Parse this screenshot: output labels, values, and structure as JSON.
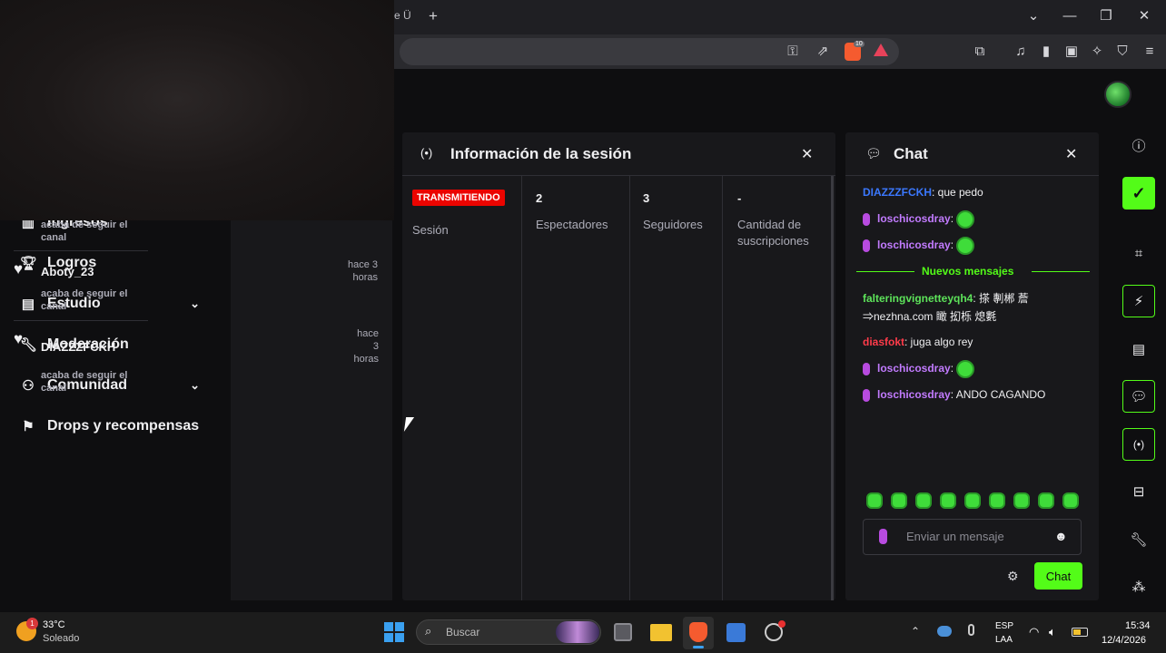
{
  "browser": {
    "tab_fragment": "e Ü",
    "new_tab": "+",
    "window_controls": {
      "dropdown": "⌄",
      "minimize": "—",
      "restore": "❐",
      "close": "✕"
    },
    "shield_count": "10"
  },
  "leftnav": {
    "items": [
      {
        "label": "Ingresos",
        "icon": "bar-chart-icon"
      },
      {
        "label": "Logros",
        "icon": "trophy-icon"
      },
      {
        "label": "Estudio",
        "icon": "studio-icon",
        "expandable": true
      },
      {
        "label": "Moderación",
        "icon": "wrench-icon"
      },
      {
        "label": "Comunidad",
        "icon": "community-icon",
        "expandable": true
      },
      {
        "label": "Drops y recompensas",
        "icon": "drops-icon"
      }
    ]
  },
  "feed": {
    "items": [
      {
        "name": "",
        "time": "",
        "action": "acaba de seguir el canal"
      },
      {
        "name": "Aboty_23",
        "time": "hace 3 horas",
        "action": "acaba de seguir el canal"
      },
      {
        "name": "DIAZZZFCKH",
        "time": "hace 3 horas",
        "action": "acaba de seguir el canal"
      }
    ]
  },
  "session": {
    "title": "Información de la sesión",
    "status_badge": "TRANSMITIENDO",
    "status_label": "Sesión",
    "stats": [
      {
        "value": "2",
        "label": "Espectadores"
      },
      {
        "value": "3",
        "label": "Seguidores"
      },
      {
        "value": "-",
        "label": "Cantidad de suscripciones"
      }
    ]
  },
  "chat": {
    "title": "Chat",
    "new_messages_label": "Nuevos mensajes",
    "messages": [
      {
        "user": "DIAZZZFCKH",
        "color": "#3b78ff",
        "text": ": que pedo"
      },
      {
        "user": "loschicosdray",
        "color": "#c27bff",
        "text": ":"
      },
      {
        "user": "loschicosdray",
        "color": "#c27bff",
        "text": ":"
      },
      {
        "user": "falteringvignetteyqh4",
        "color": "#5de35a",
        "text": ": 搽 剸郴 薝 ⇒nezhna.com 瞰 抝栎 熄氀"
      },
      {
        "user": "diasfokt",
        "color": "#ff3b4a",
        "text": ": juga algo rey"
      },
      {
        "user": "loschicosdray",
        "color": "#c27bff",
        "text": ":"
      },
      {
        "user": "loschicosdray",
        "color": "#c27bff",
        "text": ": ANDO CAGANDO"
      }
    ],
    "input_placeholder": "Enviar un mensaje",
    "send_label": "Chat",
    "accent": "#53fc18"
  },
  "taskbar": {
    "weather_temp": "33°C",
    "weather_desc": "Soleado",
    "weather_badge": "1",
    "search_placeholder": "Buscar",
    "lang_top": "ESP",
    "lang_bottom": "LAA",
    "time": "15:34",
    "date": "12/4/2026"
  }
}
